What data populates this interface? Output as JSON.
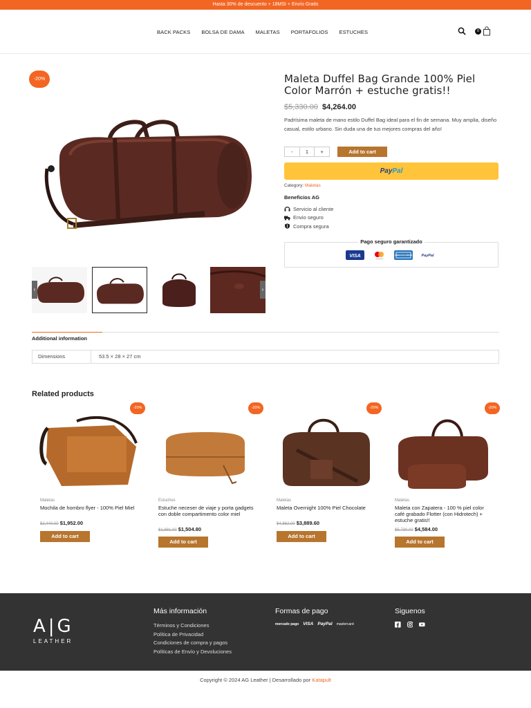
{
  "topbar": {
    "text": "Hasta 30% de descuento + 18MSI + Envío Gratis"
  },
  "nav": {
    "items": [
      "BACK PACKS",
      "BOLSA DE DAMA",
      "MALETAS",
      "PORTAFOLIOS",
      "ESTUCHES"
    ],
    "cart_count": "0"
  },
  "product": {
    "badge": "-20%",
    "title": "Maleta Duffel Bag Grande 100% Piel Color Marrón + estuche gratis!!",
    "price_old": "$5,330.00",
    "price_new": "$4,264.00",
    "description": "Padrísima maleta de mano estilo Duffel Bag ideal para el fin de semana. Muy amplia, diseño casual, estilo urbano. Sin duda una de tus mejores compras del año!",
    "qty_minus": "-",
    "qty_value": "1",
    "qty_plus": "+",
    "add_to_cart": "Add to cart",
    "paypal_label": "Pay",
    "paypal_label2": "Pal",
    "category_label": "Category:",
    "category_value": "Maletas",
    "benefits_title": "Beneficios AG",
    "benefits": [
      "Servicio al cliente",
      "Envio seguro",
      "Compra segura"
    ],
    "secure_title": "Pago seguro garantizado",
    "secure_logos": [
      "VISA",
      "mastercard",
      "AMERICAN EXPRESS",
      "PayPal"
    ]
  },
  "tabs": {
    "active": "Additional information",
    "dim_key": "Dimensions",
    "dim_value": "53.5 × 28 × 27 cm"
  },
  "related": {
    "title": "Related products",
    "products": [
      {
        "badge": "-20%",
        "category": "Maletas",
        "name": "Mochila de hombro flyer - 100% Piel Miel",
        "price_old": "$2,440.00",
        "price_new": "$1,952.00",
        "cta": "Add to cart"
      },
      {
        "badge": "-20%",
        "category": "Estuches",
        "name": "Estuche neceser de viaje y porta gadgets con doble compartimento color miel",
        "price_old": "$1,881.00",
        "price_new": "$1,504.80",
        "cta": "Add to cart"
      },
      {
        "badge": "-20%",
        "category": "Maletas",
        "name": "Maleta Overnight 100% Piel Chocolate",
        "price_old": "$4,862.00",
        "price_new": "$3,889.60",
        "cta": "Add to cart"
      },
      {
        "badge": "-20%",
        "category": "Maletas",
        "name": "Maleta con Zapatera - 100 % piel color café grabado Flotter (con Hidrotech) + estuche gratis!!",
        "price_old": "$5,730.00",
        "price_new": "$4,584.00",
        "cta": "Add to cart"
      }
    ]
  },
  "footer": {
    "logo_main": "A|G",
    "logo_sub": "LEATHER",
    "info_title": "Más información",
    "info_links": [
      "Términos y Condiciones",
      "Política de Privacidad",
      "Condiciones de compra y pagos",
      "Políticas de Envío y Devoluciones"
    ],
    "payments_title": "Formas de pago",
    "payment_logos": [
      "mercado pago",
      "VISA",
      "PayPal",
      "mastercard"
    ],
    "social_title": "Siguenos",
    "copyright": "Copyright © 2024 AG Leather | Desarrollado por",
    "developer": "Katapult"
  },
  "colors": {
    "accent": "#f26522",
    "button": "#b7752e",
    "paypal": "#ffc43a",
    "footer": "#333333"
  }
}
